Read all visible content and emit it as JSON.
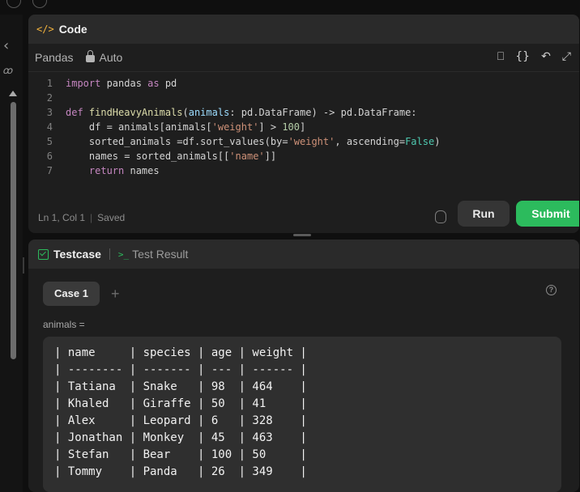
{
  "colors": {
    "accent_green": "#2cbb5d",
    "code_tag": "#f3b33d",
    "panel_bg": "#1e1e1e"
  },
  "icons": {
    "collapse": "chevron-left-icon",
    "lock": "lock-icon",
    "bookmark": "bookmark-icon",
    "format": "braces-icon",
    "reset": "undo-icon",
    "expand": "expand-icon",
    "debug": "bug-icon",
    "help": "question-icon",
    "add_case": "plus-icon"
  },
  "code_panel": {
    "tag": "</>",
    "title": "Code",
    "language": "Pandas",
    "mode": "Auto",
    "lines": [
      {
        "n": "1"
      },
      {
        "n": "2"
      },
      {
        "n": "3"
      },
      {
        "n": "4"
      },
      {
        "n": "5"
      },
      {
        "n": "6"
      },
      {
        "n": "7"
      }
    ],
    "tokens": {
      "l1_import": "import",
      "l1_rest": " pandas ",
      "l1_as": "as",
      "l1_pd": " pd",
      "l3_def": "def ",
      "l3_fn": "findHeavyAnimals",
      "l3_a": "(",
      "l3_param": "animals",
      "l3_b": ": pd.",
      "l3_type": "DataFrame",
      "l3_c": ") -> pd.",
      "l3_ret": "DataFrame",
      "l3_d": ":",
      "l4_a": "    df = animals[animals[",
      "l4_str": "'weight'",
      "l4_b": "] > ",
      "l4_num": "100",
      "l4_c": "]",
      "l5_a": "    sorted_animals =df.",
      "l5_fn": "sort_values",
      "l5_b": "(by=",
      "l5_str": "'weight'",
      "l5_c": ", ",
      "l5_kw": "ascending",
      "l5_d": "=",
      "l5_false": "False",
      "l5_e": ")",
      "l6_a": "    names = sorted_animals[[",
      "l6_str": "'name'",
      "l6_b": "]]",
      "l7_ret": "    return",
      "l7_rest": " names"
    },
    "status_pos": "Ln 1, Col 1",
    "status_saved": "Saved",
    "run_label": "Run",
    "submit_label": "Submit"
  },
  "test_panel": {
    "tab_testcase": "Testcase",
    "tab_result_icon": ">_",
    "tab_result": "Test Result",
    "case_label": "Case 1",
    "plus": "+",
    "help_glyph": "?",
    "var_label": "animals =",
    "rows": [
      "| name     | species | age | weight |",
      "| -------- | ------- | --- | ------ |",
      "| Tatiana  | Snake   | 98  | 464    |",
      "| Khaled   | Giraffe | 50  | 41     |",
      "| Alex     | Leopard | 6   | 328    |",
      "| Jonathan | Monkey  | 45  | 463    |",
      "| Stefan   | Bear    | 100 | 50     |",
      "| Tommy    | Panda   | 26  | 349    |"
    ]
  }
}
